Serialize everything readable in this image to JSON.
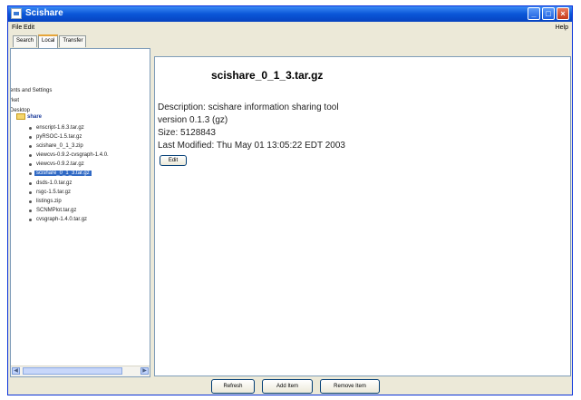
{
  "window": {
    "title": "Scishare"
  },
  "menu": {
    "file": "File",
    "edit": "Edit",
    "help": "Help"
  },
  "tabs": [
    "Search",
    "Local",
    "Transfer"
  ],
  "tree": {
    "partials": [
      "ents and Settings",
      "rket",
      "Desktop"
    ],
    "folder": "share",
    "items": [
      "enscript-1.6.3.tar.gz",
      "pyRSOC-1.5.tar.gz",
      "scishare_0_1_3.zip",
      "viewcvs-0.9.2-cvsgraph-1.4.0.",
      "viewcvs-0.9.2.tar.gz",
      "scishare_0_1_3.tar.gz",
      "dsds-1.0.tar.gz",
      "rsgc-1.5.tar.gz",
      "listings.zip",
      "SCNMPlot.tar.gz",
      "cvsgraph-1.4.0.tar.gz"
    ]
  },
  "detail": {
    "title": "scishare_0_1_3.tar.gz",
    "description": "Description: scishare information sharing tool",
    "version": "version 0.1.3 (gz)",
    "size": "Size: 5128843",
    "modified": "Last Modified: Thu May 01 13:05:22 EDT 2003",
    "edit_label": "Edit"
  },
  "buttons": {
    "refresh": "Refresh",
    "add": "Add Item",
    "remove": "Remove Item"
  }
}
